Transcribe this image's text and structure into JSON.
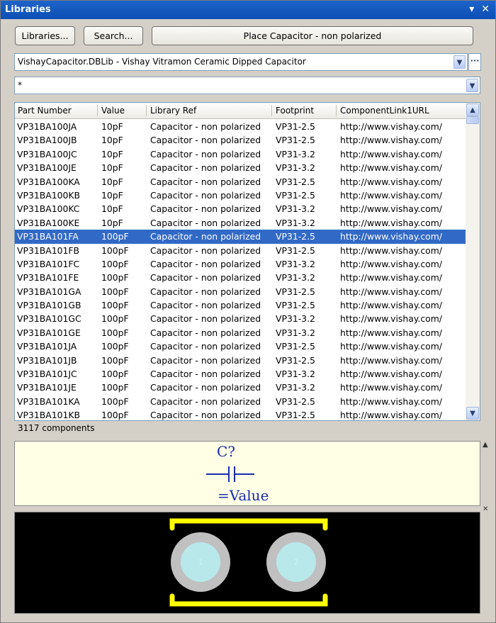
{
  "window": {
    "title": "Libraries"
  },
  "toolbar": {
    "libraries_label": "Libraries...",
    "search_label": "Search...",
    "place_label": "Place Capacitor - non polarized"
  },
  "library_select": {
    "value": "VishayCapacitor.DBLib - Vishay Vitramon Ceramic Dipped Capacitor"
  },
  "filter": {
    "value": "*"
  },
  "table": {
    "columns": [
      "Part Number",
      "Value",
      "Library Ref",
      "Footprint",
      "ComponentLink1URL"
    ],
    "rows": [
      [
        "VP31BA100JA",
        "10pF",
        "Capacitor - non polarized",
        "VP31-2.5",
        "http://www.vishay.com/"
      ],
      [
        "VP31BA100JB",
        "10pF",
        "Capacitor - non polarized",
        "VP31-2.5",
        "http://www.vishay.com/"
      ],
      [
        "VP31BA100JC",
        "10pF",
        "Capacitor - non polarized",
        "VP31-3.2",
        "http://www.vishay.com/"
      ],
      [
        "VP31BA100JE",
        "10pF",
        "Capacitor - non polarized",
        "VP31-3.2",
        "http://www.vishay.com/"
      ],
      [
        "VP31BA100KA",
        "10pF",
        "Capacitor - non polarized",
        "VP31-2.5",
        "http://www.vishay.com/"
      ],
      [
        "VP31BA100KB",
        "10pF",
        "Capacitor - non polarized",
        "VP31-2.5",
        "http://www.vishay.com/"
      ],
      [
        "VP31BA100KC",
        "10pF",
        "Capacitor - non polarized",
        "VP31-3.2",
        "http://www.vishay.com/"
      ],
      [
        "VP31BA100KE",
        "10pF",
        "Capacitor - non polarized",
        "VP31-3.2",
        "http://www.vishay.com/"
      ],
      [
        "VP31BA101FA",
        "100pF",
        "Capacitor - non polarized",
        "VP31-2.5",
        "http://www.vishay.com/"
      ],
      [
        "VP31BA101FB",
        "100pF",
        "Capacitor - non polarized",
        "VP31-2.5",
        "http://www.vishay.com/"
      ],
      [
        "VP31BA101FC",
        "100pF",
        "Capacitor - non polarized",
        "VP31-3.2",
        "http://www.vishay.com/"
      ],
      [
        "VP31BA101FE",
        "100pF",
        "Capacitor - non polarized",
        "VP31-3.2",
        "http://www.vishay.com/"
      ],
      [
        "VP31BA101GA",
        "100pF",
        "Capacitor - non polarized",
        "VP31-2.5",
        "http://www.vishay.com/"
      ],
      [
        "VP31BA101GB",
        "100pF",
        "Capacitor - non polarized",
        "VP31-2.5",
        "http://www.vishay.com/"
      ],
      [
        "VP31BA101GC",
        "100pF",
        "Capacitor - non polarized",
        "VP31-3.2",
        "http://www.vishay.com/"
      ],
      [
        "VP31BA101GE",
        "100pF",
        "Capacitor - non polarized",
        "VP31-3.2",
        "http://www.vishay.com/"
      ],
      [
        "VP31BA101JA",
        "100pF",
        "Capacitor - non polarized",
        "VP31-2.5",
        "http://www.vishay.com/"
      ],
      [
        "VP31BA101JB",
        "100pF",
        "Capacitor - non polarized",
        "VP31-2.5",
        "http://www.vishay.com/"
      ],
      [
        "VP31BA101JC",
        "100pF",
        "Capacitor - non polarized",
        "VP31-3.2",
        "http://www.vishay.com/"
      ],
      [
        "VP31BA101JE",
        "100pF",
        "Capacitor - non polarized",
        "VP31-3.2",
        "http://www.vishay.com/"
      ],
      [
        "VP31BA101KA",
        "100pF",
        "Capacitor - non polarized",
        "VP31-2.5",
        "http://www.vishay.com/"
      ],
      [
        "VP31BA101KB",
        "100pF",
        "Capacitor - non polarized",
        "VP31-2.5",
        "http://www.vishay.com/"
      ]
    ],
    "selected_index": 8
  },
  "status": {
    "count_text": "3117 components"
  },
  "schematic_preview": {
    "designator": "C?",
    "value_text": "=Value"
  },
  "pcb_preview": {
    "pad1": "1",
    "pad2": "2"
  },
  "icons": {
    "dropdown": "chevron-down-icon",
    "more": "ellipsis-icon",
    "pin": "pin-icon",
    "close": "close-icon",
    "scroll_up": "scroll-up-icon",
    "scroll_down": "scroll-down-icon"
  },
  "colors": {
    "title_bar": "#0c4fb4",
    "selection": "#3169c6",
    "schematic_ink": "#1a2bb0",
    "schematic_bg": "#ffffe6",
    "pcb_bg": "#000000",
    "silkscreen": "#ffff00",
    "pad": "#c0c0c0",
    "pad_hole": "#b8e8ea"
  }
}
